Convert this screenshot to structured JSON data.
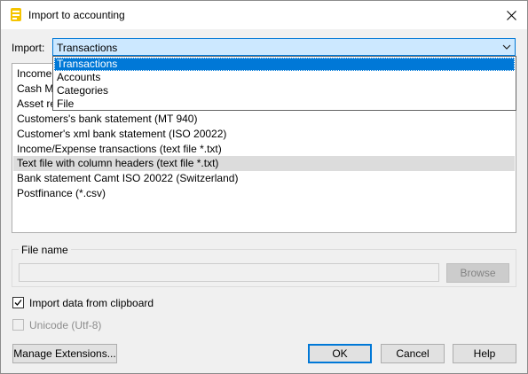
{
  "window": {
    "title": "Import to accounting"
  },
  "import": {
    "label": "Import:",
    "selected": "Transactions",
    "dropdown_options": [
      "Transactions",
      "Accounts",
      "Categories",
      "File"
    ]
  },
  "format_list": {
    "items": [
      "Income",
      "Cash M",
      "Asset re",
      "Customers's bank statement (MT 940)",
      "Customer's xml bank statement (ISO 20022)",
      "Income/Expense transactions (text file *.txt)",
      "Text file with column headers (text file *.txt)",
      "Bank statement Camt ISO 20022 (Switzerland)",
      "Postfinance (*.csv)"
    ],
    "selected_index": 6
  },
  "file_group": {
    "title": "File name",
    "value": "",
    "browse_label": "Browse"
  },
  "options": {
    "clipboard_label": "Import data from clipboard",
    "clipboard_checked": true,
    "unicode_label": "Unicode (Utf-8)",
    "unicode_checked": false
  },
  "buttons": {
    "manage_extensions": "Manage Extensions...",
    "ok": "OK",
    "cancel": "Cancel",
    "help": "Help"
  },
  "colors": {
    "accent": "#0078d7",
    "select_bg": "#cce8ff",
    "list_selection": "#dcdcdc"
  },
  "icons": {
    "app": "banana-app-icon",
    "close": "close-icon",
    "dropdown": "chevron-down-icon",
    "check": "checkmark-icon"
  }
}
